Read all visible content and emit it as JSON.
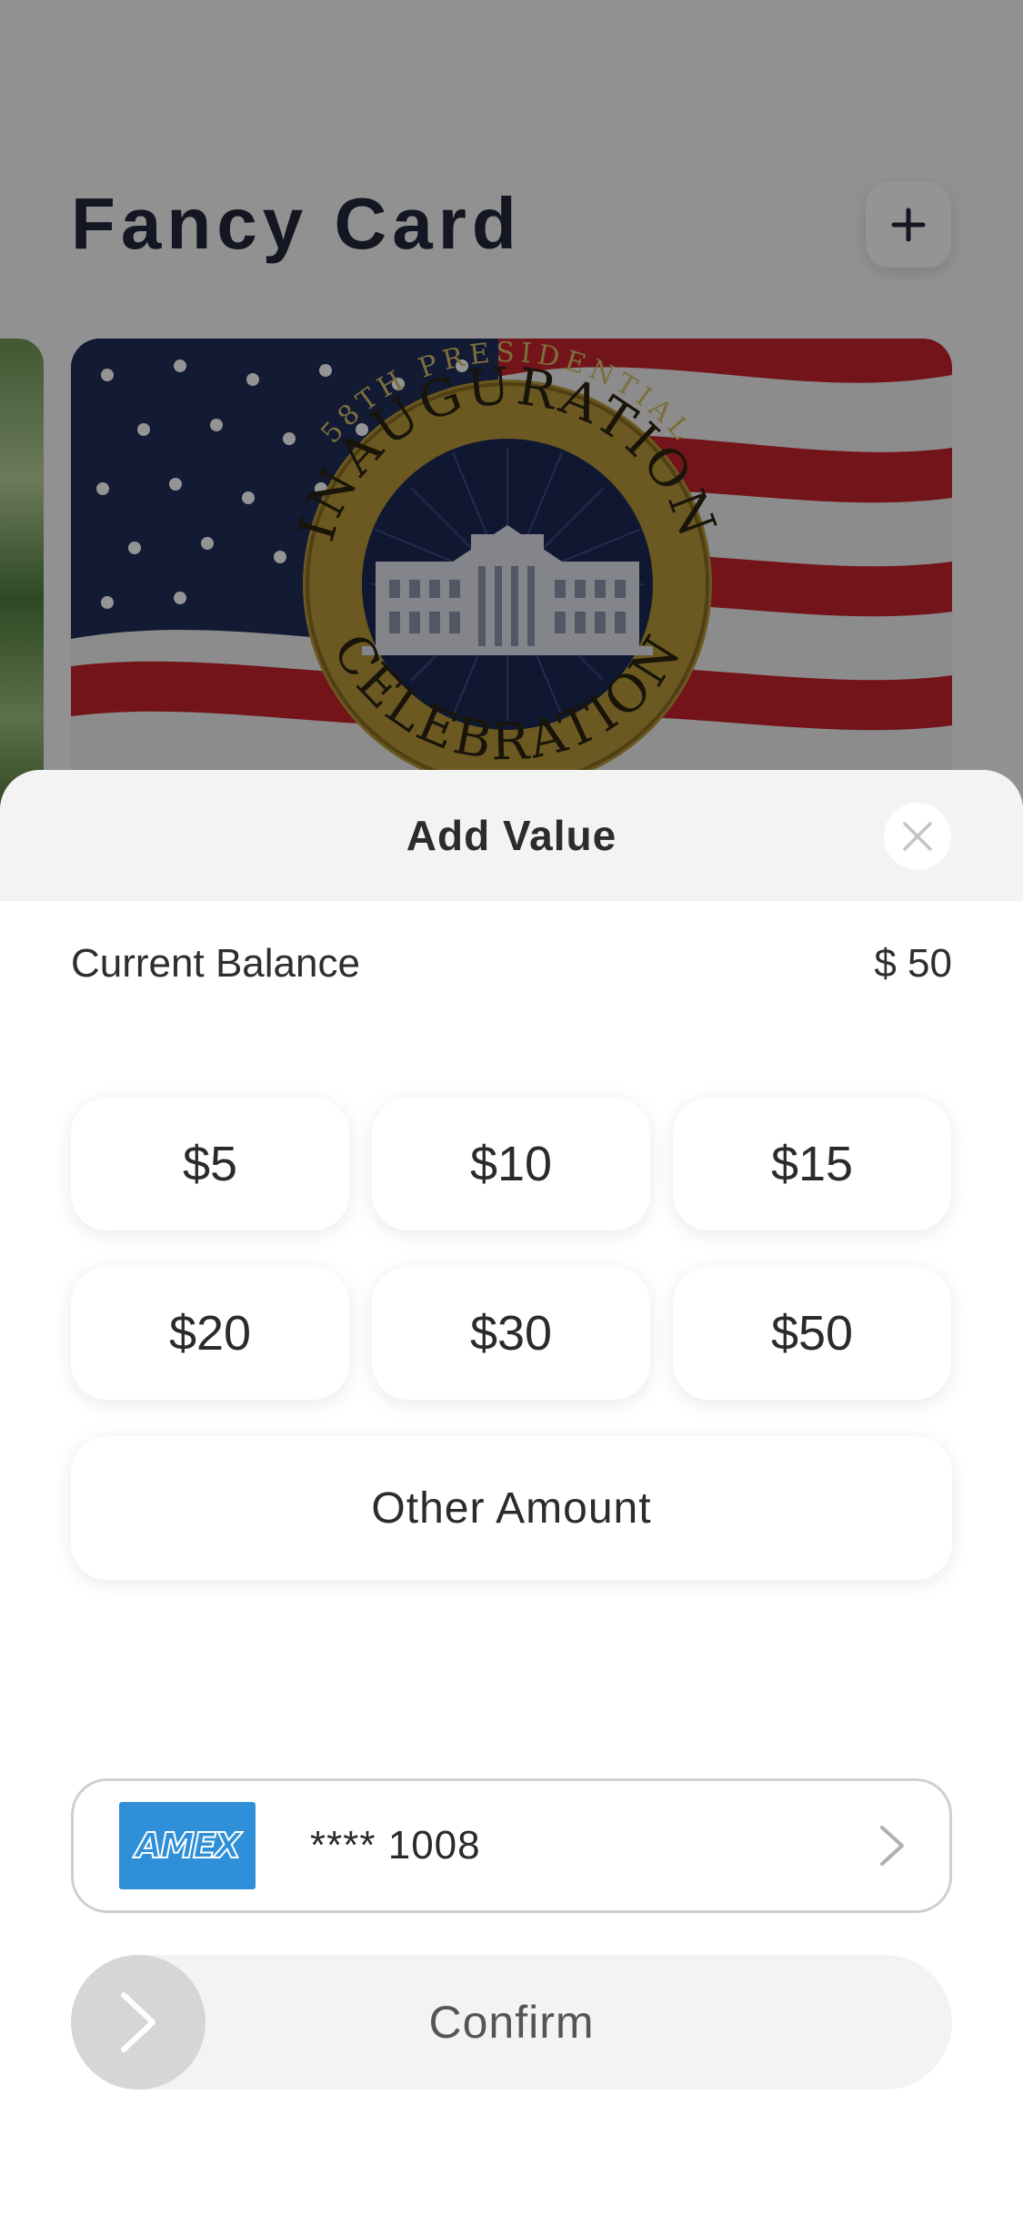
{
  "background_screen": {
    "title": "Fancy Card",
    "add_button_icon": "plus-icon",
    "card_image": {
      "top_arc_text": "58TH PRESIDENTIAL",
      "ring_top_text": "INAUGURATION",
      "ring_bottom_text": "CELEBRATION"
    }
  },
  "sheet": {
    "title": "Add Value",
    "close_icon": "close-icon",
    "balance": {
      "label": "Current Balance",
      "value": "$ 50"
    },
    "amounts": [
      {
        "label": "$5"
      },
      {
        "label": "$10"
      },
      {
        "label": "$15"
      },
      {
        "label": "$20"
      },
      {
        "label": "$30"
      },
      {
        "label": "$50"
      }
    ],
    "other_amount_label": "Other Amount",
    "payment": {
      "brand": "AMEX",
      "masked_number": "**** 1008",
      "chevron_icon": "chevron-right-icon"
    },
    "confirm": {
      "label": "Confirm",
      "knob_icon": "chevron-right-icon"
    }
  },
  "colors": {
    "amex_blue": "#2f8fd8",
    "dim_overlay": "rgba(0,0,0,0.42)",
    "text_dark": "#2b2b2b",
    "title_navy": "#23263b"
  }
}
